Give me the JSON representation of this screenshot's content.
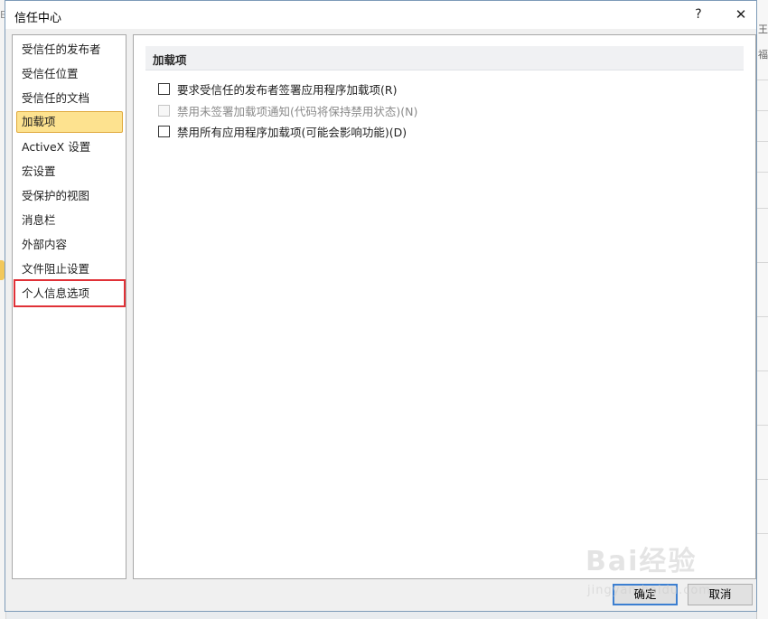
{
  "window": {
    "title": "信任中心",
    "help_label": "?",
    "close_label": "✕"
  },
  "background": {
    "left_letter": "E",
    "right_glyphs": [
      "王",
      "福"
    ]
  },
  "sidebar": {
    "items": [
      {
        "label": "受信任的发布者"
      },
      {
        "label": "受信任位置"
      },
      {
        "label": "受信任的文档"
      },
      {
        "label": "加载项"
      },
      {
        "label": "ActiveX 设置"
      },
      {
        "label": "宏设置"
      },
      {
        "label": "受保护的视图"
      },
      {
        "label": "消息栏"
      },
      {
        "label": "外部内容"
      },
      {
        "label": "文件阻止设置"
      },
      {
        "label": "个人信息选项"
      }
    ],
    "selected_index": 3,
    "highlighted_index": 10
  },
  "content": {
    "section_title": "加载项",
    "options": [
      {
        "label": "要求受信任的发布者签署应用程序加载项(R)",
        "checked": false,
        "enabled": true
      },
      {
        "label": "禁用未签署加载项通知(代码将保持禁用状态)(N)",
        "checked": false,
        "enabled": false
      },
      {
        "label": "禁用所有应用程序加载项(可能会影响功能)(D)",
        "checked": false,
        "enabled": true
      }
    ]
  },
  "buttons": {
    "ok": "确定",
    "cancel": "取消"
  },
  "watermark": {
    "logo": "Bai经验",
    "url": "jingyan.baidu.com"
  },
  "colors": {
    "selected_bg": "#fde28f",
    "highlight_border": "#e03137",
    "default_button_border": "#3c7fd1"
  }
}
